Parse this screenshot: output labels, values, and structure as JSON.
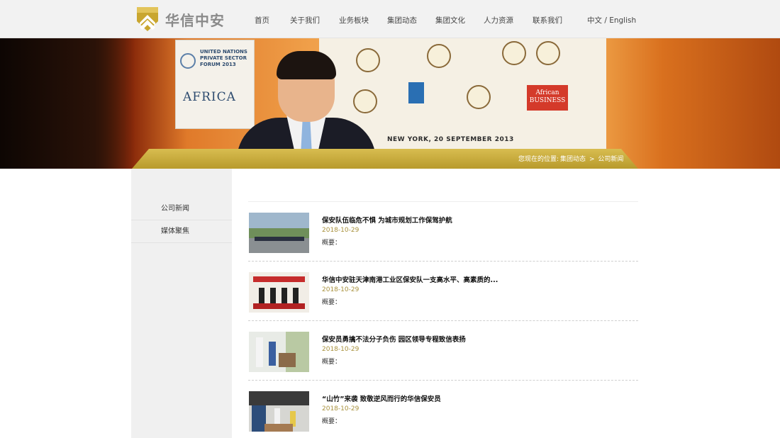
{
  "header": {
    "logo_text": "华信中安",
    "nav": [
      {
        "label": "首页"
      },
      {
        "label": "关于我们"
      },
      {
        "label": "业务板块"
      },
      {
        "label": "集团动态"
      },
      {
        "label": "集团文化"
      },
      {
        "label": "人力资源"
      },
      {
        "label": "联系我们"
      }
    ],
    "language": "中文 / English"
  },
  "banner": {
    "poster_title": "UNITED NATIONS PRIVATE SECTOR FORUM 2013",
    "poster_africa": "AFRICA",
    "backdrop_caption": "NEW YORK, 20 SEPTEMBER 2013",
    "backdrop_biz": "African BUSINESS",
    "breadcrumb": {
      "prefix": "您现在的位置:",
      "level1": "集团动态",
      "separator": ">",
      "level2": "公司新闻"
    }
  },
  "sidebar": {
    "items": [
      {
        "label": "公司新闻"
      },
      {
        "label": "媒体聚焦"
      }
    ]
  },
  "news": {
    "summary_label": "概要：",
    "items": [
      {
        "title": "保安队伍临危不惧 为城市规划工作保驾护航",
        "date": "2018-10-29"
      },
      {
        "title": "华信中安驻天津南港工业区保安队一支高水平、高素质的...",
        "date": "2018-10-29"
      },
      {
        "title": "保安员勇擒不法分子负伤 园区领导专程致信表扬",
        "date": "2018-10-29"
      },
      {
        "title": "“山竹”来袭 致敬逆风而行的华信保安员",
        "date": "2018-10-29"
      }
    ]
  },
  "colors": {
    "gold": "#b89a2c",
    "date": "#a8913c",
    "header_bg": "#f2f2f2",
    "sidebar_bg": "#f0f0f0"
  }
}
